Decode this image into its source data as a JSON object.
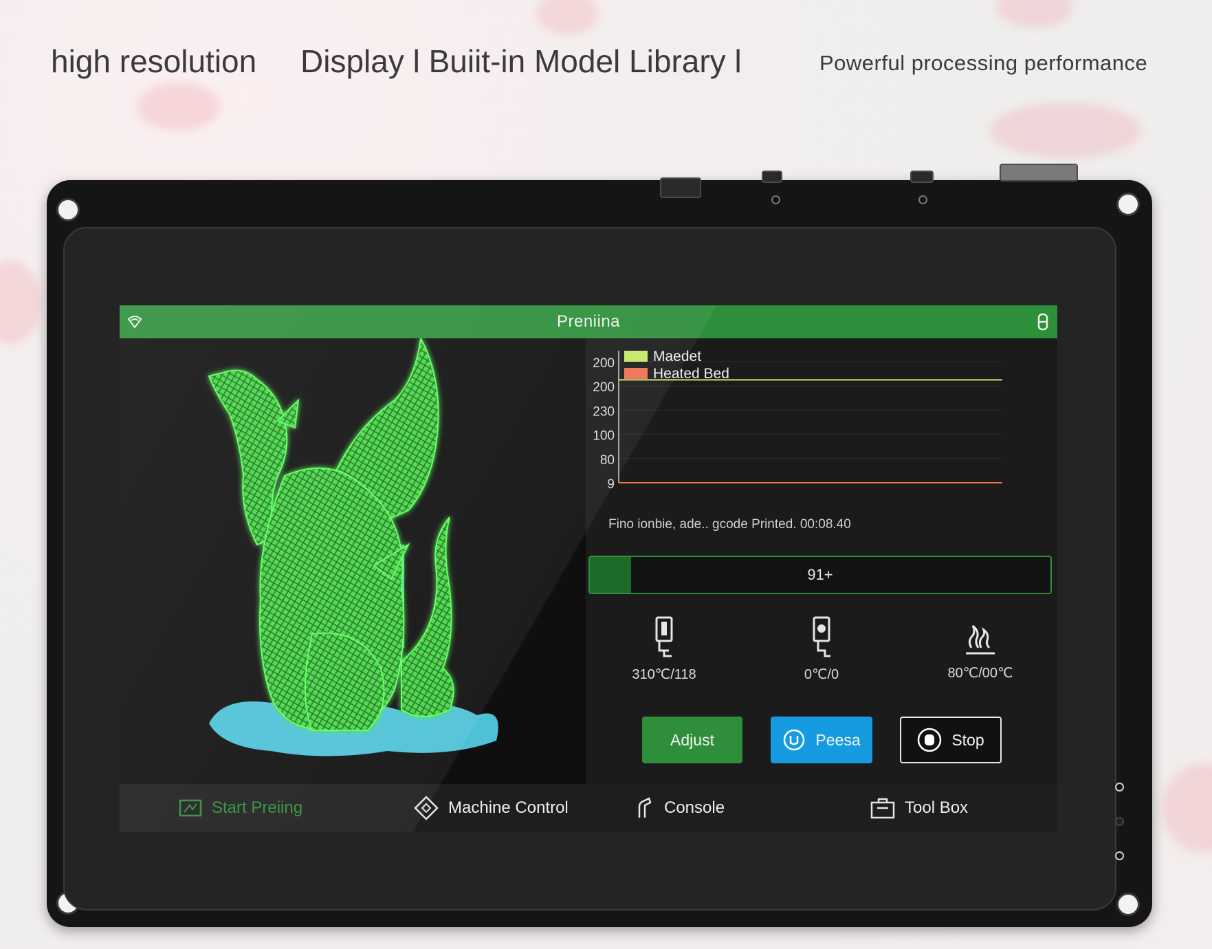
{
  "headline": {
    "left": "high resolution",
    "middle": "Display l Buiit-in Model Library l",
    "right": "Powerful processing performance"
  },
  "screen": {
    "title": "Preniina",
    "wifi_icon": "wifi-icon",
    "battery_icon": "battery-icon",
    "file_status": "Fino ionbie, ade.. gcode Printed. 00:08.40",
    "progress": {
      "label": "91+",
      "percent": 9
    },
    "stats": [
      {
        "icon": "nozzle-icon",
        "value": "310℃/118"
      },
      {
        "icon": "extruder-icon",
        "value": "0℃/0"
      },
      {
        "icon": "heated-bed-icon",
        "value": "80℃/00℃"
      }
    ],
    "buttons": {
      "adjust": "Adjust",
      "pause": "Peesa",
      "stop": "Stop"
    },
    "nav": [
      {
        "label": "Start Preiing",
        "icon": "print-icon",
        "active": true
      },
      {
        "label": "Machine Control",
        "icon": "control-icon",
        "active": false
      },
      {
        "label": "Console",
        "icon": "console-icon",
        "active": false
      },
      {
        "label": "Tool Box",
        "icon": "toolbox-icon",
        "active": false
      }
    ]
  },
  "chart_data": {
    "type": "line",
    "title": "",
    "xlabel": "",
    "ylabel": "",
    "tick_labels": [
      "200",
      "200",
      "230",
      "100",
      "80",
      "9"
    ],
    "legend_placement": "top-left",
    "grid": true,
    "series": [
      {
        "name": "Maedet",
        "color": "#c6e86a",
        "level_tick_index": 0.75
      },
      {
        "name": "Heated Bed",
        "color": "#f07050",
        "level_tick_index": 5
      }
    ]
  },
  "colors": {
    "accent_green": "#2f8e3a",
    "pause_blue": "#169ae0",
    "model_green": "#4ee64e",
    "model_base_cyan": "#54d6ec"
  }
}
